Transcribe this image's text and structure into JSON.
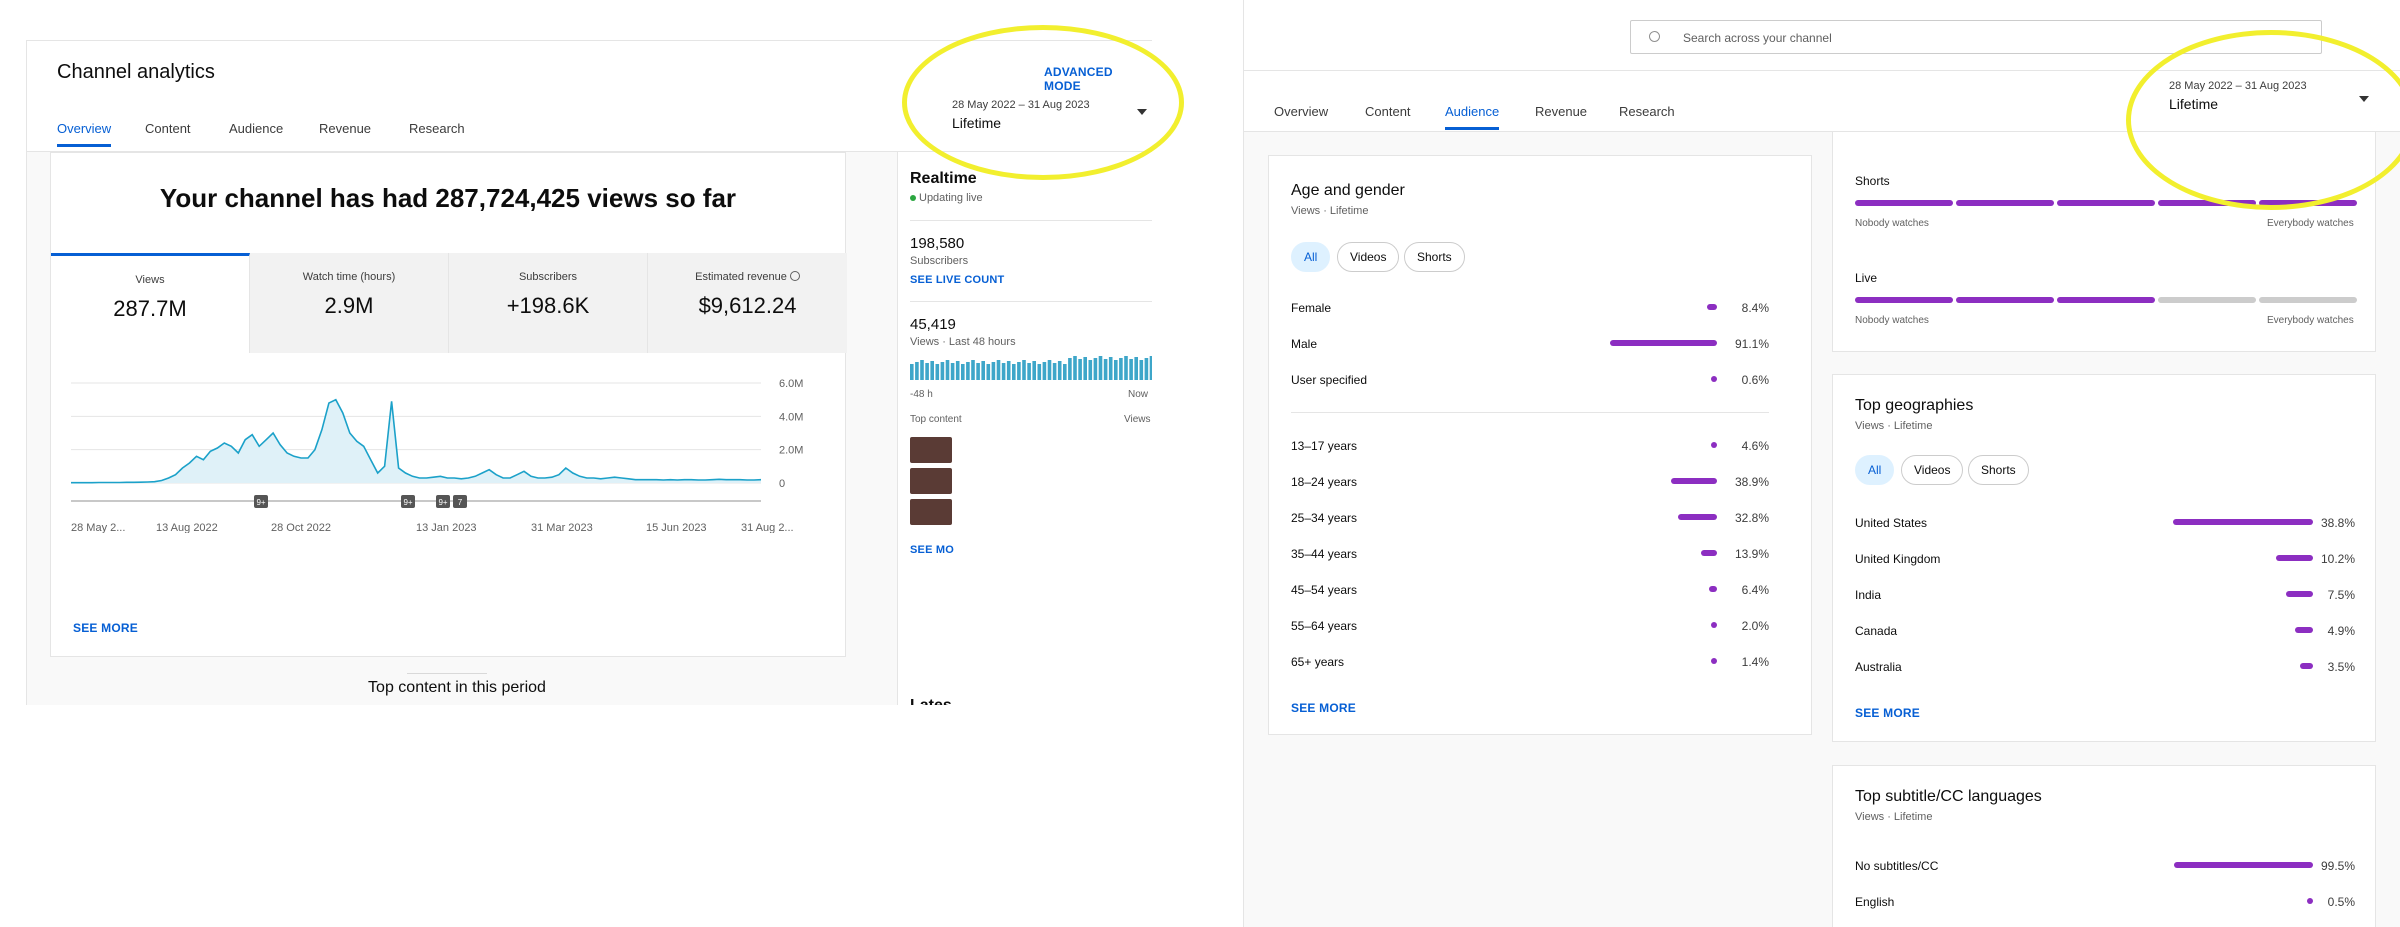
{
  "left": {
    "title": "Channel analytics",
    "advanced_mode": "ADVANCED MODE",
    "date_range": "28 May 2022 – 31 Aug 2023",
    "date_period": "Lifetime",
    "tabs": [
      "Overview",
      "Content",
      "Audience",
      "Revenue",
      "Research"
    ],
    "headline": "Your channel has had 287,724,425 views so far",
    "metrics": [
      {
        "label": "Views",
        "value": "287.7M"
      },
      {
        "label": "Watch time (hours)",
        "value": "2.9M"
      },
      {
        "label": "Subscribers",
        "value": "+198.6K"
      },
      {
        "label": "Estimated revenue",
        "value": "$9,612.24"
      }
    ],
    "see_more": "SEE MORE",
    "top_content_heading": "Top content in this period",
    "realtime": {
      "title": "Realtime",
      "updating": "Updating live",
      "subscribers": "198,580",
      "subscribers_label": "Subscribers",
      "see_live_count": "SEE LIVE COUNT",
      "views": "45,419",
      "views_label": "Views · Last 48 hours",
      "axis_start": "-48 h",
      "axis_end": "Now",
      "top_content": "Top content",
      "views_col": "Views",
      "see_more_partial": "SEE MO",
      "latest_partial": "Lates"
    }
  },
  "chart_data": {
    "type": "area",
    "x_tick_labels": [
      "28 May 2...",
      "13 Aug 2022",
      "28 Oct 2022",
      "13 Jan 2023",
      "31 Mar 2023",
      "15 Jun 2023",
      "31 Aug 2..."
    ],
    "y_tick_labels": [
      "6.0M",
      "4.0M",
      "2.0M",
      "0"
    ],
    "ylim": [
      0,
      6000000
    ],
    "series": [
      {
        "values": [
          0.02,
          0.02,
          0.02,
          0.02,
          0.03,
          0.03,
          0.03,
          0.03,
          0.04,
          0.04,
          0.05,
          0.06,
          0.08,
          0.15,
          0.3,
          0.5,
          0.9,
          1.2,
          1.6,
          1.4,
          1.9,
          2.1,
          2.4,
          2.2,
          1.8,
          2.6,
          2.9,
          2.2,
          2.6,
          3.0,
          2.3,
          1.8,
          1.6,
          1.5,
          1.5,
          2.0,
          3.2,
          4.8,
          5.0,
          4.2,
          3.0,
          2.5,
          2.2,
          1.4,
          0.6,
          1.0,
          4.9,
          0.9,
          0.6,
          0.4,
          0.3,
          0.3,
          0.35,
          0.4,
          0.3,
          0.3,
          0.25,
          0.3,
          0.4,
          0.6,
          0.8,
          0.5,
          0.3,
          0.3,
          0.5,
          0.7,
          0.4,
          0.3,
          0.3,
          0.35,
          0.5,
          0.9,
          0.6,
          0.4,
          0.3,
          0.3,
          0.25,
          0.3,
          0.35,
          0.3,
          0.25,
          0.2,
          0.2,
          0.2,
          0.2,
          0.18,
          0.2,
          0.18,
          0.2,
          0.2,
          0.18,
          0.18,
          0.2,
          0.22,
          0.2,
          0.2,
          0.2,
          0.18,
          0.18,
          0.2
        ],
        "unit": "M"
      }
    ],
    "markers": [
      "9+",
      "9+",
      "9+",
      "7"
    ]
  },
  "right": {
    "search_placeholder": "Search across your channel",
    "date_range": "28 May 2022 – 31 Aug 2023",
    "date_period": "Lifetime",
    "tabs": [
      "Overview",
      "Content",
      "Audience",
      "Revenue",
      "Research"
    ],
    "age_gender": {
      "title": "Age and gender",
      "subtitle": "Views · Lifetime",
      "chips": [
        "All",
        "Videos",
        "Shorts"
      ],
      "gender": [
        {
          "name": "Female",
          "pct": "8.4%",
          "value": 8.4
        },
        {
          "name": "Male",
          "pct": "91.1%",
          "value": 91.1
        },
        {
          "name": "User specified",
          "pct": "0.6%",
          "value": 0.6
        }
      ],
      "age": [
        {
          "name": "13–17 years",
          "pct": "4.6%",
          "value": 4.6
        },
        {
          "name": "18–24 years",
          "pct": "38.9%",
          "value": 38.9
        },
        {
          "name": "25–34 years",
          "pct": "32.8%",
          "value": 32.8
        },
        {
          "name": "35–44 years",
          "pct": "13.9%",
          "value": 13.9
        },
        {
          "name": "45–54 years",
          "pct": "6.4%",
          "value": 6.4
        },
        {
          "name": "55–64 years",
          "pct": "2.0%",
          "value": 2.0
        },
        {
          "name": "65+ years",
          "pct": "1.4%",
          "value": 1.4
        }
      ],
      "see_more": "SEE MORE"
    },
    "watch_behavior": {
      "shorts_label": "Shorts",
      "shorts_level": 5,
      "live_label": "Live",
      "live_level": 3,
      "low": "Nobody watches",
      "high": "Everybody watches"
    },
    "geographies": {
      "title": "Top geographies",
      "subtitle": "Views · Lifetime",
      "chips": [
        "All",
        "Videos",
        "Shorts"
      ],
      "rows": [
        {
          "name": "United States",
          "pct": "38.8%",
          "value": 38.8
        },
        {
          "name": "United Kingdom",
          "pct": "10.2%",
          "value": 10.2
        },
        {
          "name": "India",
          "pct": "7.5%",
          "value": 7.5
        },
        {
          "name": "Canada",
          "pct": "4.9%",
          "value": 4.9
        },
        {
          "name": "Australia",
          "pct": "3.5%",
          "value": 3.5
        }
      ],
      "see_more": "SEE MORE"
    },
    "subtitles": {
      "title": "Top subtitle/CC languages",
      "subtitle": "Views · Lifetime",
      "rows": [
        {
          "name": "No subtitles/CC",
          "pct": "99.5%",
          "value": 99.5
        },
        {
          "name": "English",
          "pct": "0.5%",
          "value": 0.5
        }
      ]
    }
  },
  "colors": {
    "accent": "#065fd4",
    "bar": "#8c2ec1",
    "chart_line": "#1ba1c9",
    "highlight": "#f2ef2e"
  }
}
